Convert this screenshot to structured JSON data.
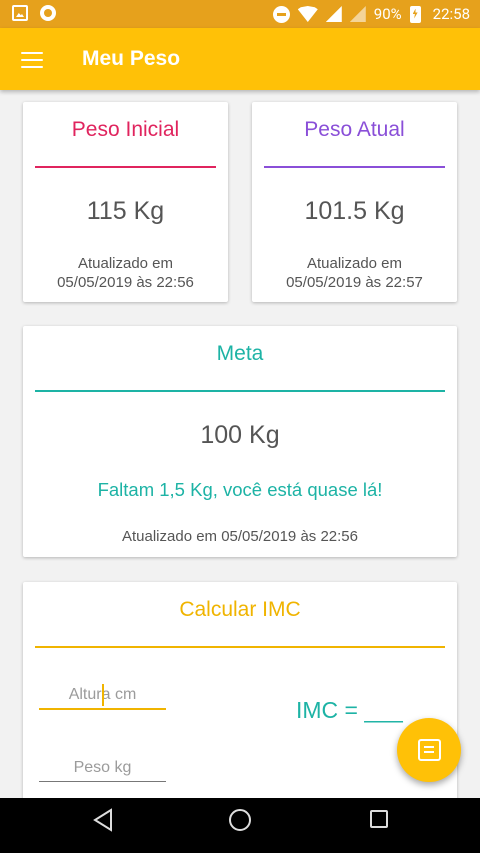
{
  "status_bar": {
    "battery": "90%",
    "time": "22:58"
  },
  "app_bar": {
    "title": "Meu Peso"
  },
  "peso_inicial": {
    "title": "Peso Inicial",
    "value": "115 Kg",
    "updated_line1": "Atualizado em",
    "updated_line2": "05/05/2019 às 22:56"
  },
  "peso_atual": {
    "title": "Peso Atual",
    "value": "101.5 Kg",
    "updated_line1": "Atualizado em",
    "updated_line2": "05/05/2019 às 22:57"
  },
  "meta": {
    "title": "Meta",
    "value": "100 Kg",
    "message": "Faltam 1,5 Kg, você está quase lá!",
    "updated": "Atualizado em 05/05/2019 às 22:56"
  },
  "imc": {
    "title": "Calcular IMC",
    "altura_placeholder": "Altura  cm",
    "peso_placeholder": "Peso  kg",
    "result": "IMC = ___"
  },
  "colors": {
    "status_bar": "#e6a11c",
    "app_bar": "#ffc107",
    "peso_inicial": "#e0245e",
    "peso_atual": "#8a4fd8",
    "meta": "#1db3a5",
    "imc": "#f0b400"
  },
  "icons": {
    "menu": "menu-icon",
    "fab": "notes-icon",
    "nav_back": "back-icon",
    "nav_home": "home-icon",
    "nav_recent": "recent-apps-icon"
  }
}
